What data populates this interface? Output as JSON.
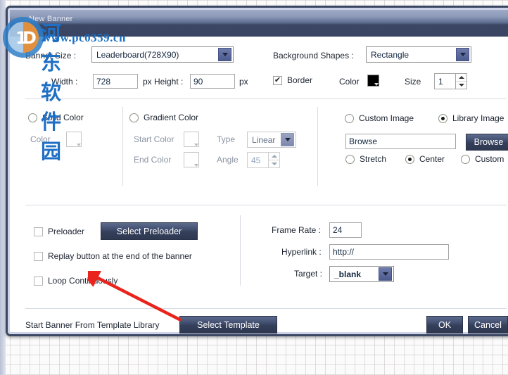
{
  "window": {
    "title": "New Banner"
  },
  "watermark": {
    "site_cn": "河东软件园",
    "site_url": "www.pc0359.cn",
    "logo_icon": "circle-logo-icon"
  },
  "banner_size": {
    "label": "Banner Size :",
    "value": "Leaderboard(728X90)",
    "dropdown_icon": "chevron-down-icon"
  },
  "background_shapes": {
    "label": "Background Shapes :",
    "value": "Rectangle",
    "dropdown_icon": "chevron-down-icon"
  },
  "dimensions": {
    "width_label": "Width :",
    "width_value": "728",
    "width_unit": "px",
    "height_label": "Height :",
    "height_value": "90",
    "height_unit": "px"
  },
  "border": {
    "checkbox_label": "Border",
    "checked": true,
    "check_glyph": "✔",
    "color_label": "Color",
    "color_value": "#000000",
    "size_label": "Size",
    "size_value": "1"
  },
  "fill_panel": {
    "solid": {
      "radio_label": "Solid Color",
      "selected": false,
      "color_label": "Color"
    },
    "gradient": {
      "radio_label": "Gradient Color",
      "selected": false,
      "start_color_label": "Start Color",
      "end_color_label": "End Color",
      "type_label": "Type",
      "type_value": "Linear",
      "angle_label": "Angle",
      "angle_value": "45"
    },
    "image": {
      "custom_image_label": "Custom Image",
      "custom_image_selected": false,
      "library_image_label": "Library Image",
      "library_image_selected": true,
      "path_value": "Browse",
      "browse_button": "Browse",
      "stretch_label": "Stretch",
      "stretch_selected": false,
      "center_label": "Center",
      "center_selected": true,
      "custom_label": "Custom",
      "custom_selected": false
    }
  },
  "playback": {
    "preloader_label": "Preloader",
    "preloader_checked": false,
    "select_preloader_button": "Select Preloader",
    "replay_label": "Replay button at the end of the banner",
    "replay_checked": false,
    "loop_label": "Loop Continuously",
    "loop_checked": false
  },
  "settings": {
    "frame_rate_label": "Frame Rate :",
    "frame_rate_value": "24",
    "hyperlink_label": "Hyperlink :",
    "hyperlink_value": "http://",
    "target_label": "Target :",
    "target_value": "_blank",
    "dropdown_icon": "chevron-down-icon"
  },
  "footer": {
    "template_text": "Start Banner From Template Library",
    "select_template_button": "Select Template",
    "ok_button": "OK",
    "cancel_button": "Cancel"
  },
  "annotation": {
    "arrow_icon": "red-arrow-icon",
    "arrow_color": "#e8241c"
  },
  "colors": {
    "titlebar_dark": "#394562",
    "dialog_border": "#3b4763",
    "accent_button": "#3f4c6c",
    "combo_button": "#4d5b8d"
  }
}
